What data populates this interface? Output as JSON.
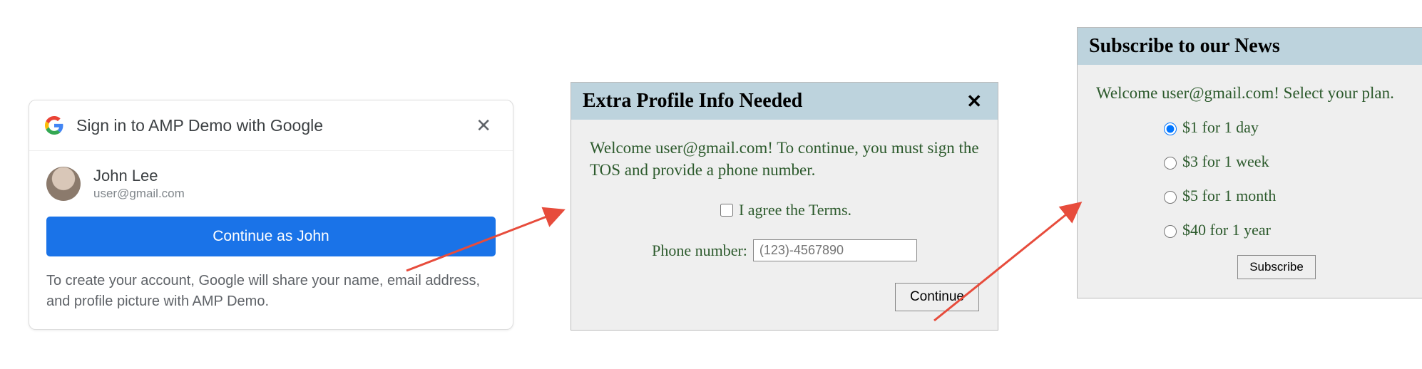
{
  "google": {
    "title": "Sign in to AMP Demo with Google",
    "user_name": "John Lee",
    "user_email": "user@gmail.com",
    "continue_label": "Continue as John",
    "disclaimer": "To create your account, Google will share your name, email address, and profile picture with AMP Demo."
  },
  "profile_popup": {
    "title": "Extra Profile Info Needed",
    "welcome_text": "Welcome user@gmail.com! To continue, you must sign the TOS and provide a phone number.",
    "terms_label": "I agree the Terms.",
    "phone_label": "Phone number:",
    "phone_placeholder": "(123)-4567890",
    "continue_label": "Continue"
  },
  "subscribe_popup": {
    "title": "Subscribe to our News",
    "welcome_text": "Welcome user@gmail.com! Select your plan.",
    "plans": [
      {
        "label": "$1 for 1 day",
        "selected": true
      },
      {
        "label": "$3 for 1 week",
        "selected": false
      },
      {
        "label": "$5 for 1 month",
        "selected": false
      },
      {
        "label": "$40 for 1 year",
        "selected": false
      }
    ],
    "subscribe_label": "Subscribe"
  }
}
